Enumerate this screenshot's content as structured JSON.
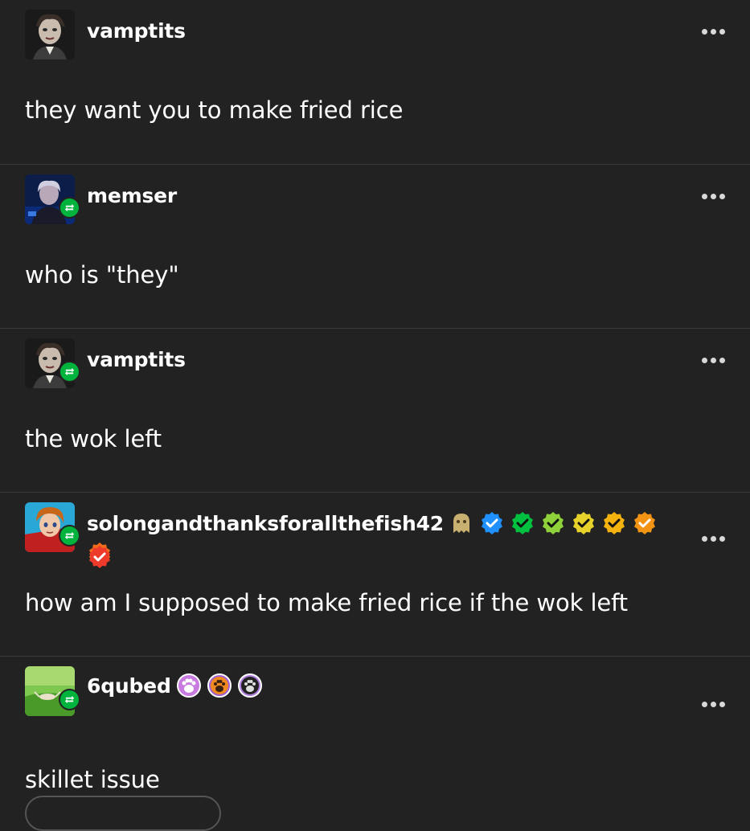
{
  "thread": {
    "posts": [
      {
        "username": "vamptits",
        "is_reblog": false,
        "body": "they want you to make fried rice",
        "badges": []
      },
      {
        "username": "memser",
        "is_reblog": true,
        "body": "who is \"they\"",
        "badges": []
      },
      {
        "username": "vamptits",
        "is_reblog": true,
        "body": "the wok left",
        "badges": []
      },
      {
        "username": "solongandthanksforallthefish42",
        "is_reblog": true,
        "body": "how am I supposed to make fried rice if the wok left",
        "badges": [
          "ghost-badge",
          "verified-blue",
          "verified-green",
          "verified-lime",
          "verified-yellow",
          "verified-amber",
          "verified-orange",
          "verified-orange-red",
          "verified-red"
        ]
      },
      {
        "username": "6qubed",
        "is_reblog": true,
        "body": "skillet issue",
        "badges": [
          "paw-pink-badge",
          "paw-orange-badge",
          "paw-purple-badge"
        ]
      }
    ]
  },
  "colors": {
    "background": "#222222",
    "divider": "#3a3a3a",
    "reblog_green": "#00b33c",
    "text": "#ffffff"
  }
}
